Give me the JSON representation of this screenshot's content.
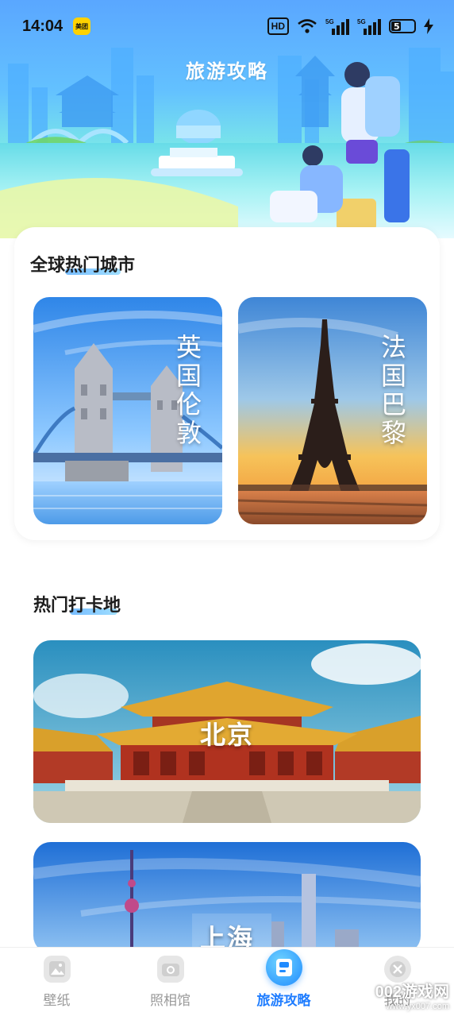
{
  "status_bar": {
    "time": "14:04",
    "app_badge": "美团",
    "hd": "HD",
    "network": "5G",
    "battery": "5"
  },
  "header": {
    "title": "旅游攻略"
  },
  "hot_cities": {
    "title": "全球热门城市",
    "items": [
      {
        "name": "英国伦敦"
      },
      {
        "name": "法国巴黎"
      }
    ]
  },
  "check_in": {
    "title": "热门打卡地",
    "items": [
      {
        "name": "北京"
      },
      {
        "name": "上海"
      }
    ]
  },
  "bottom_nav": {
    "items": [
      {
        "label": "壁纸",
        "icon": "image-icon"
      },
      {
        "label": "照相馆",
        "icon": "camera-icon"
      },
      {
        "label": "旅游攻略",
        "icon": "guide-icon",
        "active": true
      },
      {
        "label": "我的",
        "icon": "profile-icon"
      }
    ]
  },
  "watermark": {
    "brand": "002游戏网",
    "url": "www.yx007.com"
  },
  "colors": {
    "accent": "#1f7dff",
    "hero_sky": "#5aa7ff",
    "hero_water": "#67dce8"
  }
}
